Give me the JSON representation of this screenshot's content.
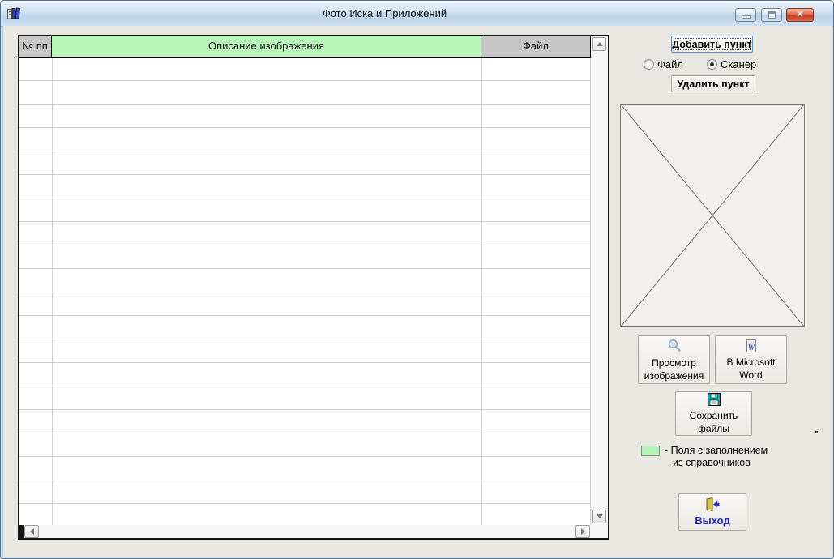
{
  "window": {
    "title": "Фото Иска и Приложений",
    "icons": {
      "close_glyph": "✕"
    }
  },
  "table": {
    "columns": [
      {
        "label": "№ пп"
      },
      {
        "label": "Описание изображения"
      },
      {
        "label": "Файл"
      }
    ],
    "rows": []
  },
  "panel": {
    "add_button": "Добавить пункт",
    "radios": [
      {
        "label": "Файл",
        "selected": false
      },
      {
        "label": "Сканер",
        "selected": true
      }
    ],
    "delete_button": "Удалить пункт",
    "preview_button": {
      "line1": "Просмотр",
      "line2": "изображения"
    },
    "word_button": {
      "line1": "В Microsoft",
      "line2": "Word"
    },
    "save_button": {
      "line1": "Сохранить",
      "line2": "файлы"
    },
    "legend": {
      "line1": "-  Поля с заполнением",
      "line2": "из справочников"
    },
    "exit_button": "Выход"
  },
  "colors": {
    "reference_field_green": "#B9F6B9",
    "header_gray": "#C6C6C6",
    "exit_label_blue": "#2228C8"
  }
}
